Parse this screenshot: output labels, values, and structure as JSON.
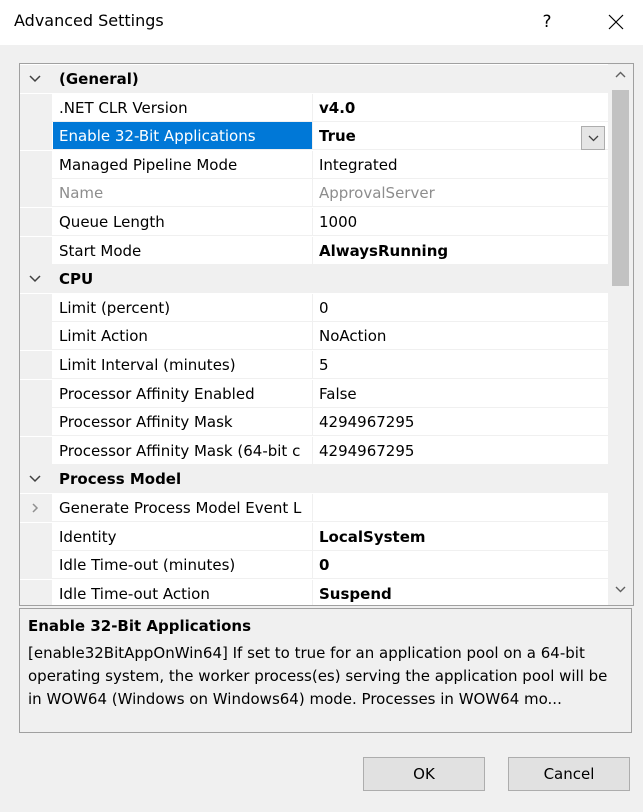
{
  "window": {
    "title": "Advanced Settings",
    "help_label": "?"
  },
  "grid": {
    "rows": [
      {
        "kind": "category",
        "label": "(General)",
        "expanded": true
      },
      {
        "kind": "prop",
        "name": ".NET CLR Version",
        "value": "v4.0",
        "bold": true
      },
      {
        "kind": "prop",
        "name": "Enable 32-Bit Applications",
        "value": "True",
        "bold": true,
        "selected": true,
        "dropdown": true
      },
      {
        "kind": "prop",
        "name": "Managed Pipeline Mode",
        "value": "Integrated"
      },
      {
        "kind": "prop",
        "name": "Name",
        "value": "ApprovalServer",
        "disabled": true
      },
      {
        "kind": "prop",
        "name": "Queue Length",
        "value": "1000"
      },
      {
        "kind": "prop",
        "name": "Start Mode",
        "value": "AlwaysRunning",
        "bold": true
      },
      {
        "kind": "category",
        "label": "CPU",
        "expanded": true
      },
      {
        "kind": "prop",
        "name": "Limit (percent)",
        "value": "0"
      },
      {
        "kind": "prop",
        "name": "Limit Action",
        "value": "NoAction"
      },
      {
        "kind": "prop",
        "name": "Limit Interval (minutes)",
        "value": "5"
      },
      {
        "kind": "prop",
        "name": "Processor Affinity Enabled",
        "value": "False"
      },
      {
        "kind": "prop",
        "name": "Processor Affinity Mask",
        "value": "4294967295"
      },
      {
        "kind": "prop",
        "name": "Processor Affinity Mask (64-bit c",
        "value": "4294967295"
      },
      {
        "kind": "category",
        "label": "Process Model",
        "expanded": true
      },
      {
        "kind": "prop",
        "name": "Generate Process Model Event L",
        "value": "",
        "collapsed_child": true
      },
      {
        "kind": "prop",
        "name": "Identity",
        "value": "LocalSystem",
        "bold": true
      },
      {
        "kind": "prop",
        "name": "Idle Time-out (minutes)",
        "value": "0",
        "bold": true
      },
      {
        "kind": "prop",
        "name": "Idle Time-out Action",
        "value": "Suspend",
        "bold": true
      }
    ]
  },
  "description": {
    "title": "Enable 32-Bit Applications",
    "text": "[enable32BitAppOnWin64] If set to true for an application pool on a 64-bit operating system, the worker process(es) serving the application pool will be in WOW64 (Windows on Windows64) mode. Processes in WOW64 mo..."
  },
  "buttons": {
    "ok": "OK",
    "cancel": "Cancel"
  },
  "colors": {
    "selection": "#0078d7",
    "category_bg": "#f0f0f0",
    "disabled_text": "#8d8d8d"
  },
  "icons": {
    "help": "question-mark",
    "close": "close-x",
    "expanded": "chevron-down",
    "collapsed": "chevron-right",
    "dropdown": "chevron-down",
    "scroll_up": "chevron-up",
    "scroll_down": "chevron-down"
  }
}
